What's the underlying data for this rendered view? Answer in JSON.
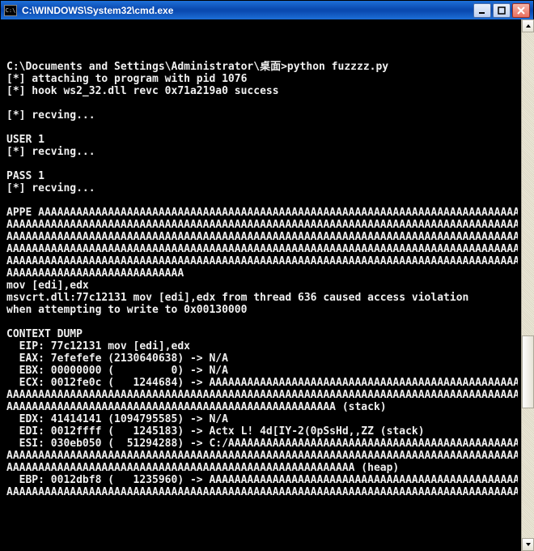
{
  "window": {
    "icon_text": "C:\\",
    "title": "C:\\WINDOWS\\System32\\cmd.exe"
  },
  "terminal": {
    "lines": [
      "",
      "C:\\Documents and Settings\\Administrator\\桌面>python fuzzzz.py",
      "[*] attaching to program with pid 1076",
      "[*] hook ws2_32.dll revc 0x71a219a0 success",
      "",
      "[*] recving...",
      "",
      "USER 1",
      "[*] recving...",
      "",
      "PASS 1",
      "[*] recving...",
      "",
      "APPE AAAAAAAAAAAAAAAAAAAAAAAAAAAAAAAAAAAAAAAAAAAAAAAAAAAAAAAAAAAAAAAAAAAAAAAAAAAAAAAA",
      "AAAAAAAAAAAAAAAAAAAAAAAAAAAAAAAAAAAAAAAAAAAAAAAAAAAAAAAAAAAAAAAAAAAAAAAAAAAAAAAAAAAAA",
      "AAAAAAAAAAAAAAAAAAAAAAAAAAAAAAAAAAAAAAAAAAAAAAAAAAAAAAAAAAAAAAAAAAAAAAAAAAAAAAAAAAAAA",
      "AAAAAAAAAAAAAAAAAAAAAAAAAAAAAAAAAAAAAAAAAAAAAAAAAAAAAAAAAAAAAAAAAAAAAAAAAAAAAAAAAAAAA",
      "AAAAAAAAAAAAAAAAAAAAAAAAAAAAAAAAAAAAAAAAAAAAAAAAAAAAAAAAAAAAAAAAAAAAAAAAAAAAAAAAAAAAA",
      "AAAAAAAAAAAAAAAAAAAAAAAAAAAA",
      "mov [edi],edx",
      "msvcrt.dll:77c12131 mov [edi],edx from thread 636 caused access violation",
      "when attempting to write to 0x00130000",
      "",
      "CONTEXT DUMP",
      "  EIP: 77c12131 mov [edi],edx",
      "  EAX: 7efefefe (2130640638) -> N/A",
      "  EBX: 00000000 (         0) -> N/A",
      "  ECX: 0012fe0c (   1244684) -> AAAAAAAAAAAAAAAAAAAAAAAAAAAAAAAAAAAAAAAAAAAAAAAAAAAAA",
      "AAAAAAAAAAAAAAAAAAAAAAAAAAAAAAAAAAAAAAAAAAAAAAAAAAAAAAAAAAAAAAAAAAAAAAAAAAAAAAAAAAAAA",
      "AAAAAAAAAAAAAAAAAAAAAAAAAAAAAAAAAAAAAAAAAAAAAAAAAAAA (stack)",
      "  EDX: 41414141 (1094795585) -> N/A",
      "  EDI: 0012ffff (   1245183) -> Actx L! 4d[IY-2(0pSsHd,,ZZ (stack)",
      "  ESI: 030eb050 (  51294288) -> C:/AAAAAAAAAAAAAAAAAAAAAAAAAAAAAAAAAAAAAAAAAAAAAAAAAA",
      "AAAAAAAAAAAAAAAAAAAAAAAAAAAAAAAAAAAAAAAAAAAAAAAAAAAAAAAAAAAAAAAAAAAAAAAAAAAAAAAAAAAAA",
      "AAAAAAAAAAAAAAAAAAAAAAAAAAAAAAAAAAAAAAAAAAAAAAAAAAAAAAA (heap)",
      "  EBP: 0012dbf8 (   1235960) -> AAAAAAAAAAAAAAAAAAAAAAAAAAAAAAAAAAAAAAAAAAAAAAAAAAAAA",
      "AAAAAAAAAAAAAAAAAAAAAAAAAAAAAAAAAAAAAAAAAAAAAAAAAAAAAAAAAAAAAAAAAAAAAAAAAAAAAAAAAAAAA"
    ]
  }
}
